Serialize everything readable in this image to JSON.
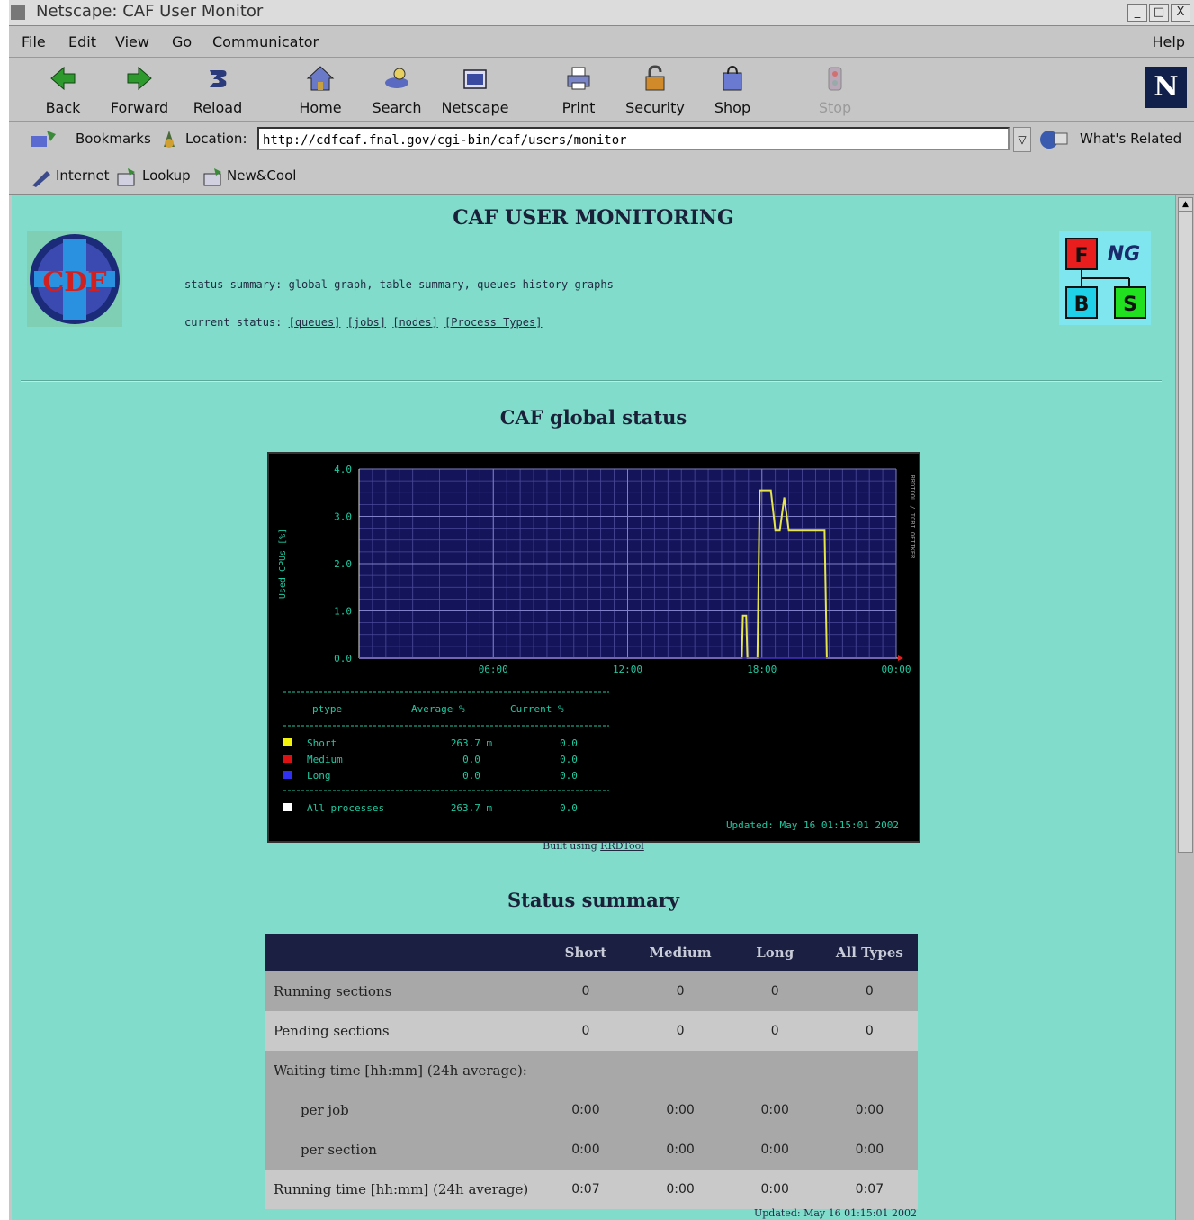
{
  "window": {
    "title": "Netscape: CAF User Monitor",
    "controls": [
      "_",
      "□",
      "X"
    ]
  },
  "menu": {
    "items": [
      "File",
      "Edit",
      "View",
      "Go",
      "Communicator"
    ],
    "help": "Help"
  },
  "toolbar": {
    "back": "Back",
    "forward": "Forward",
    "reload": "Reload",
    "home": "Home",
    "search": "Search",
    "netscape": "Netscape",
    "print": "Print",
    "security": "Security",
    "shop": "Shop",
    "stop": "Stop",
    "logo": "N"
  },
  "location": {
    "bookmarks": "Bookmarks",
    "label": "Location:",
    "url": "http://cdfcaf.fnal.gov/cgi-bin/caf/users/monitor",
    "whats_related": "What's Related"
  },
  "personal": {
    "items": [
      "Internet",
      "Lookup",
      "New&Cool"
    ]
  },
  "page": {
    "title": "CAF USER MONITORING",
    "status_summary_line": "status summary: global graph, table summary, queues history graphs",
    "current_status_label": "current status:",
    "current_status_links": [
      "[queues]",
      "[jobs]",
      "[nodes]",
      "[Process Types]"
    ],
    "logo_left": "CDF",
    "logo_right": {
      "f": "F",
      "ng": "NG",
      "b": "B",
      "s": "S"
    },
    "global_status_heading": "CAF global status",
    "graph_credit_prefix": "Built using",
    "graph_credit_link": "RRDTool",
    "summary_heading": "Status summary",
    "footer_updated": "Updated: May 16 01:15:01 2002"
  },
  "chart_data": {
    "type": "line",
    "ylabel": "Used CPUs [%]",
    "right_label": "RRDTOOL / TOBI OETIKER",
    "yticks": [
      "0.0",
      "1.0",
      "2.0",
      "3.0",
      "4.0"
    ],
    "xticks": [
      "06:00",
      "12:00",
      "18:00",
      "00:00"
    ],
    "ylim": [
      0,
      4
    ],
    "x_unit": "hours",
    "xlim": [
      0,
      24
    ],
    "grid": true,
    "series": [
      {
        "name": "Short",
        "color": "#e6e64a",
        "x": [
          0,
          17.1,
          17.15,
          17.3,
          17.35,
          17.8,
          17.9,
          18.4,
          18.6,
          18.8,
          19.0,
          19.2,
          19.4,
          19.5,
          19.7,
          20.8,
          20.9,
          21.6,
          24
        ],
        "y": [
          0,
          0,
          0.9,
          0.9,
          0,
          0,
          3.55,
          3.55,
          2.7,
          2.7,
          3.4,
          2.7,
          2.7,
          2.7,
          2.7,
          2.7,
          0,
          0,
          0
        ]
      },
      {
        "name": "Medium",
        "color": "#dd2222",
        "x": [
          0,
          24
        ],
        "y": [
          0,
          0
        ]
      },
      {
        "name": "Long",
        "color": "#3333ee",
        "x": [
          0,
          24
        ],
        "y": [
          0,
          0
        ]
      }
    ],
    "legend": {
      "headers": [
        "ptype",
        "Average %",
        "Current %"
      ],
      "rows": [
        {
          "color": "#f2f20a",
          "name": "Short",
          "avg": "263.7 m",
          "cur": "0.0"
        },
        {
          "color": "#dd1111",
          "name": "Medium",
          "avg": "0.0",
          "cur": "0.0"
        },
        {
          "color": "#3030f0",
          "name": "Long",
          "avg": "0.0",
          "cur": "0.0"
        }
      ],
      "all": {
        "color": "#ffffff",
        "name": "All processes",
        "avg": "263.7 m",
        "cur": "0.0"
      }
    },
    "updated": "Updated: May 16 01:15:01 2002"
  },
  "summary": {
    "headers": [
      "",
      "Short",
      "Medium",
      "Long",
      "All Types"
    ],
    "running_sections": {
      "label": "Running sections",
      "values": [
        "0",
        "0",
        "0",
        "0"
      ]
    },
    "pending_sections": {
      "label": "Pending sections",
      "values": [
        "0",
        "0",
        "0",
        "0"
      ]
    },
    "waiting_time": {
      "label": "Waiting time [hh:mm]   (24h average):"
    },
    "per_job": {
      "label": "per job",
      "values": [
        "0:00",
        "0:00",
        "0:00",
        "0:00"
      ]
    },
    "per_section": {
      "label": "per section",
      "values": [
        "0:00",
        "0:00",
        "0:00",
        "0:00"
      ]
    },
    "running_time": {
      "label": "Running time [hh:mm]   (24h average)",
      "values": [
        "0:07",
        "0:00",
        "0:00",
        "0:07"
      ]
    }
  }
}
